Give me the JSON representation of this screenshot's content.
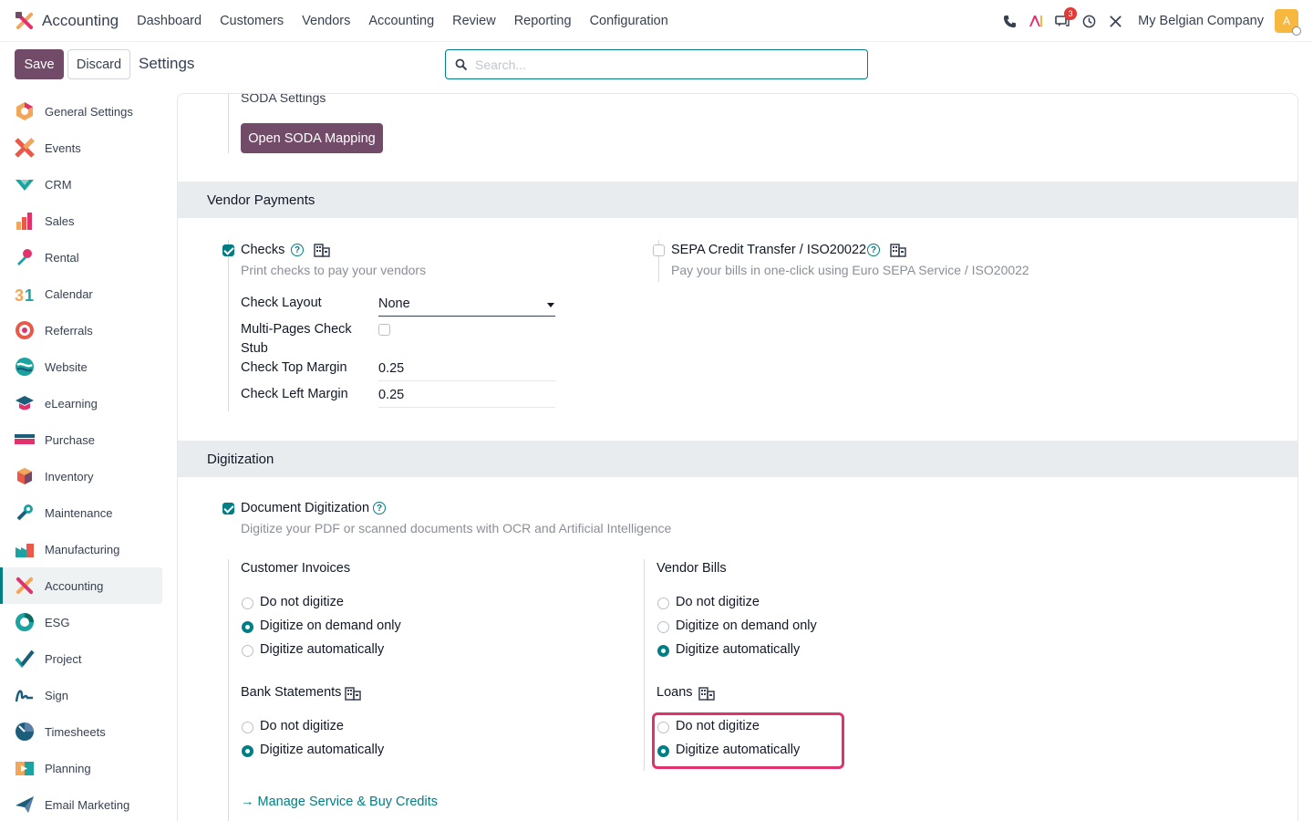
{
  "navbar": {
    "app_title": "Accounting",
    "menu": [
      "Dashboard",
      "Customers",
      "Vendors",
      "Accounting",
      "Review",
      "Reporting",
      "Configuration"
    ],
    "message_badge": "3",
    "company": "My Belgian Company",
    "avatar_letter": "A"
  },
  "control": {
    "save_label": "Save",
    "discard_label": "Discard",
    "breadcrumb": "Settings",
    "search_placeholder": "Search..."
  },
  "sidebar": {
    "items": [
      {
        "label": "General Settings",
        "icon": "general-settings-icon"
      },
      {
        "label": "Events",
        "icon": "events-icon"
      },
      {
        "label": "CRM",
        "icon": "crm-icon"
      },
      {
        "label": "Sales",
        "icon": "sales-icon"
      },
      {
        "label": "Rental",
        "icon": "rental-icon"
      },
      {
        "label": "Calendar",
        "icon": "calendar-icon"
      },
      {
        "label": "Referrals",
        "icon": "referrals-icon"
      },
      {
        "label": "Website",
        "icon": "website-icon"
      },
      {
        "label": "eLearning",
        "icon": "elearning-icon"
      },
      {
        "label": "Purchase",
        "icon": "purchase-icon"
      },
      {
        "label": "Inventory",
        "icon": "inventory-icon"
      },
      {
        "label": "Maintenance",
        "icon": "maintenance-icon"
      },
      {
        "label": "Manufacturing",
        "icon": "manufacturing-icon"
      },
      {
        "label": "Accounting",
        "icon": "accounting-icon",
        "active": true
      },
      {
        "label": "ESG",
        "icon": "esg-icon"
      },
      {
        "label": "Project",
        "icon": "project-icon"
      },
      {
        "label": "Sign",
        "icon": "sign-icon"
      },
      {
        "label": "Timesheets",
        "icon": "timesheets-icon"
      },
      {
        "label": "Planning",
        "icon": "planning-icon"
      },
      {
        "label": "Email Marketing",
        "icon": "email-marketing-icon"
      }
    ]
  },
  "soda": {
    "title": "SODA Settings",
    "button": "Open SODA Mapping"
  },
  "vendor_payments": {
    "heading": "Vendor Payments",
    "checks": {
      "label": "Checks",
      "checked": true,
      "description": "Print checks to pay your vendors",
      "check_layout_label": "Check Layout",
      "check_layout_value": "None",
      "multi_pages_label_1": "Multi-Pages Check",
      "multi_pages_label_2": "Stub",
      "multi_pages_checked": false,
      "top_margin_label": "Check Top Margin",
      "top_margin_value": "0.25",
      "left_margin_label": "Check Left Margin",
      "left_margin_value": "0.25"
    },
    "sepa": {
      "label": "SEPA Credit Transfer / ISO20022",
      "checked": false,
      "description": "Pay your bills in one-click using Euro SEPA Service / ISO20022"
    }
  },
  "digitization": {
    "heading": "Digitization",
    "document": {
      "label": "Document Digitization",
      "checked": true,
      "description": "Digitize your PDF or scanned documents with OCR and Artificial Intelligence"
    },
    "customer_invoices": {
      "title": "Customer Invoices",
      "options": [
        "Do not digitize",
        "Digitize on demand only",
        "Digitize automatically"
      ],
      "selected": 1
    },
    "vendor_bills": {
      "title": "Vendor Bills",
      "options": [
        "Do not digitize",
        "Digitize on demand only",
        "Digitize automatically"
      ],
      "selected": 2
    },
    "bank_statements": {
      "title": "Bank Statements",
      "options": [
        "Do not digitize",
        "Digitize automatically"
      ],
      "selected": 1
    },
    "loans": {
      "title": "Loans",
      "options": [
        "Do not digitize",
        "Digitize automatically"
      ],
      "selected": 1
    },
    "manage_link": "Manage Service & Buy Credits"
  },
  "colors": {
    "primary": "#714b67",
    "accent": "#017e84",
    "highlight": "#e0336e"
  }
}
